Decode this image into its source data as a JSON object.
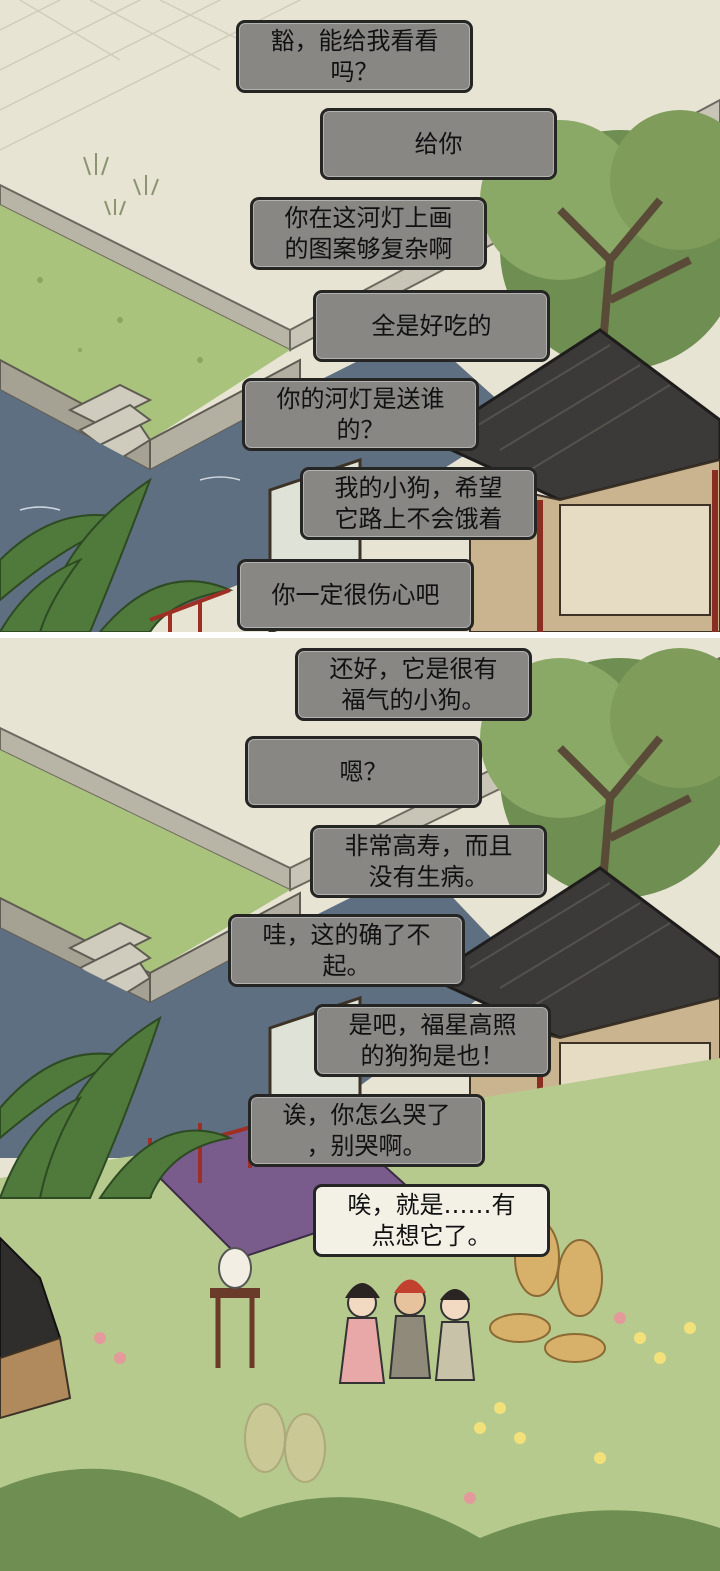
{
  "panels": [
    {
      "bubbles": [
        {
          "text": "豁，能给我看看\n吗？"
        },
        {
          "text": "给你"
        },
        {
          "text": "你在这河灯上画\n的图案够复杂啊"
        },
        {
          "text": "全是好吃的"
        },
        {
          "text": "你的河灯是送谁\n的？"
        },
        {
          "text": "我的小狗，希望\n它路上不会饿着"
        },
        {
          "text": "你一定很伤心吧"
        }
      ]
    },
    {
      "bubbles": [
        {
          "text": "还好，它是很有\n福气的小狗。"
        },
        {
          "text": "嗯？"
        },
        {
          "text": "非常高寿，而且\n没有生病。"
        },
        {
          "text": "哇，这的确了不\n起。"
        },
        {
          "text": "是吧，福星高照\n的狗狗是也！"
        },
        {
          "text": "诶，你怎么哭了\n，别哭啊。"
        },
        {
          "text": "唉，就是……有\n点想它了。"
        }
      ]
    }
  ],
  "colors": {
    "bubble_fill": "#888784",
    "bubble_fill_light": "#f3f0e6",
    "bubble_border": "#252524",
    "grass": "#a9c37c",
    "water": "#5e6f82",
    "roof": "#3b3a38",
    "paving": "#e6e2d2"
  }
}
